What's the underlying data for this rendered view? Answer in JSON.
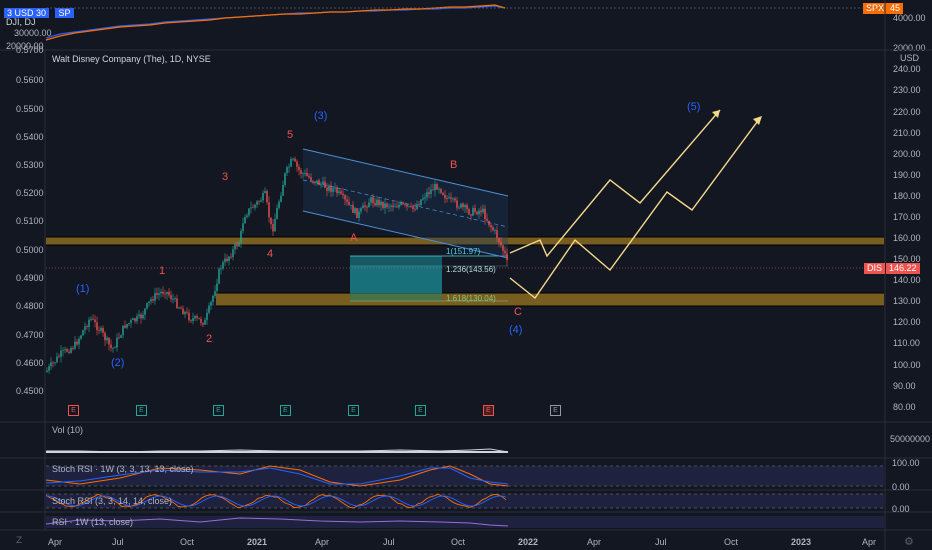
{
  "top_pane": {
    "legend_line1": "DJI, DJ",
    "legend_tag_left": "3 USD 30",
    "legend_tag_sp": "SP",
    "left_scale": [
      "30000.00",
      "20000.00"
    ],
    "spx_badge": "SPX",
    "spx_badge_value": "45",
    "right_scale": [
      "4000.00",
      "2000.00"
    ]
  },
  "main_pane": {
    "title": "Walt Disney Company (The), 1D, NYSE",
    "currency": "USD",
    "left_scale": [
      "0.5700",
      "0.5600",
      "0.5500",
      "0.5400",
      "0.5300",
      "0.5200",
      "0.5100",
      "0.5000",
      "0.4900",
      "0.4800",
      "0.4700",
      "0.4600",
      "0.4500"
    ],
    "right_scale": [
      "240.00",
      "230.00",
      "220.00",
      "210.00",
      "200.00",
      "190.00",
      "180.00",
      "170.00",
      "160.00",
      "150.00",
      "140.00",
      "130.00",
      "120.00",
      "110.00",
      "100.00",
      "90.00",
      "80.00"
    ],
    "price_badge_symbol": "DIS",
    "price_badge_value": "146.22",
    "wave_labels": {
      "w1p": "(1)",
      "w2p": "(2)",
      "w3p": "(3)",
      "w4p": "(4)",
      "w5p": "(5)",
      "w1": "1",
      "w2": "2",
      "w3": "3",
      "w4": "4",
      "w5": "5",
      "wa": "A",
      "wb": "B",
      "wc": "C"
    },
    "fib_labels": {
      "f1": "1(151.97)",
      "f1236": "1.236(143.56)",
      "f1618": "1.618(130.04)"
    },
    "earnings_marks": [
      "E",
      "E",
      "E",
      "E",
      "E",
      "E",
      "E",
      "E"
    ]
  },
  "indicator_panes": {
    "vol_label": "Vol (10)",
    "vol_scale": "50000000",
    "stoch1_label": "Stoch RSI · 1W (3, 3, 13, 13, close)",
    "stoch1_scale": [
      "100.00",
      "0.00"
    ],
    "stoch2_label": "Stoch RSI (3, 3, 14, 14, close)",
    "stoch2_scale": [
      "0.00"
    ],
    "rsi_label": "RSI · 1W (13, close)"
  },
  "time_axis": [
    "Apr",
    "Jul",
    "Oct",
    "2021",
    "Apr",
    "Jul",
    "Oct",
    "2022",
    "Apr",
    "Jul",
    "Oct",
    "2023",
    "Apr"
  ],
  "colors": {
    "background": "#131722",
    "up_candle": "#26a69a",
    "down_candle": "#ef5350",
    "orange_zone": "#8a6a1f",
    "teal_box": "#1b8f9a",
    "projection": "#f5d88c",
    "wave_blue": "#2962ff",
    "wave_red": "#ef5350",
    "channel_blue": "#4a90d9",
    "spx_badge": "#ff6d00"
  }
}
